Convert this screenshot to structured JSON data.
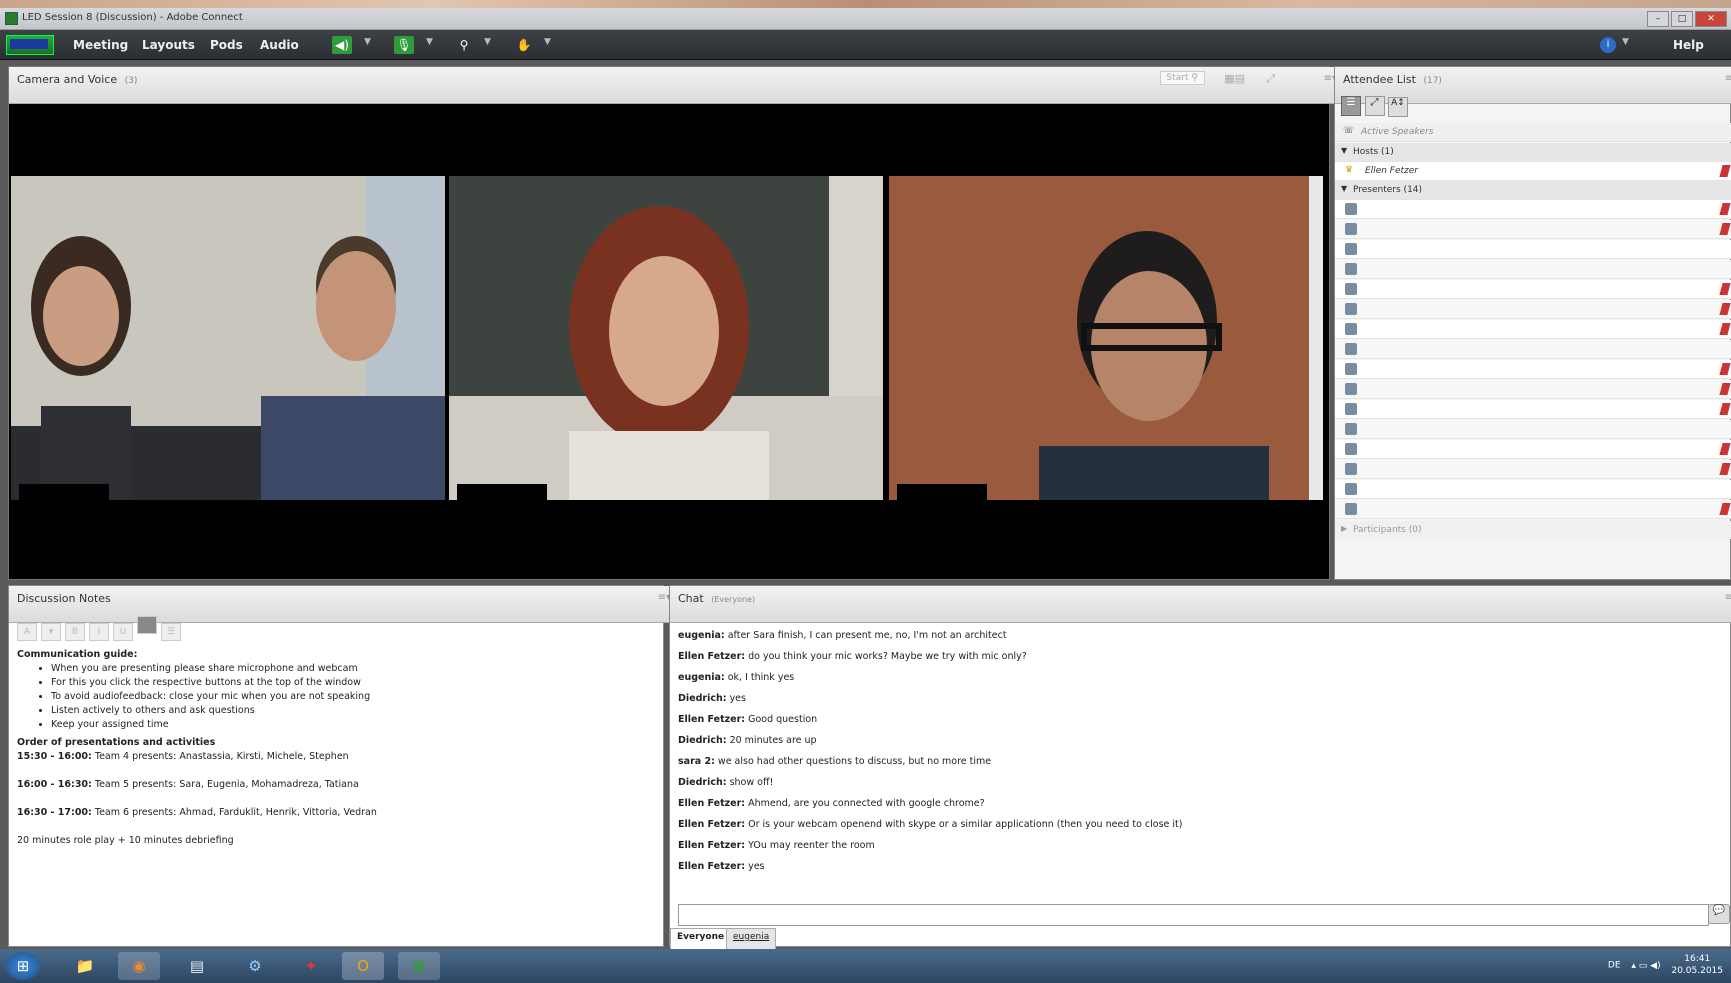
{
  "window": {
    "title": "LED Session 8 (Discussion) - Adobe Connect"
  },
  "menu": {
    "items": [
      "Meeting",
      "Layouts",
      "Pods",
      "Audio"
    ],
    "help": "Help"
  },
  "camera_pod": {
    "title": "Camera and Voice",
    "count": "(3)",
    "start_label": "Start"
  },
  "attendee_pod": {
    "title": "Attendee List",
    "count": "(17)",
    "active_speakers": "Active Speakers",
    "hosts_label": "Hosts (1)",
    "host_name": "Ellen Fetzer",
    "presenters_label": "Presenters (14)",
    "participants_label": "Participants (0)"
  },
  "notes_pod": {
    "title": "Discussion Notes",
    "guide_heading": "Communication guide:",
    "guide_items": [
      "When you are presenting please share microphone and webcam",
      "For this you click the respective buttons at the top of the window",
      "To avoid audiofeedback: close your mic when you are not speaking",
      "Listen actively to others and ask questions",
      "Keep your assigned time"
    ],
    "order_heading": "Order of presentations and activities",
    "schedule": [
      {
        "time": "15:30 - 16:00:",
        "text": "Team 4 presents: Anastassia, Kirsti, Michele, Stephen"
      },
      {
        "time": "16:00 - 16:30:",
        "text": "Team 5 presents: Sara, Eugenia, Mohamadreza, Tatiana"
      },
      {
        "time": "16:30 - 17:00:",
        "text": "Team 6 presents: Ahmad, Farduklit, Henrik, Vittoria, Vedran"
      }
    ],
    "footer": "20 minutes role play + 10 minutes debriefing"
  },
  "chat_pod": {
    "title": "Chat",
    "scope": "(Everyone)",
    "messages": [
      {
        "from": "eugenia:",
        "text": "after Sara finish, I can present me, no, I'm not an architect"
      },
      {
        "from": "Ellen Fetzer:",
        "text": "do you think your mic works? Maybe we try with mic only?"
      },
      {
        "from": "eugenia:",
        "text": "ok, I think yes"
      },
      {
        "from": "Diedrich:",
        "text": "yes"
      },
      {
        "from": "Ellen Fetzer:",
        "text": "Good question"
      },
      {
        "from": "Diedrich:",
        "text": "20 minutes are up"
      },
      {
        "from": "sara 2:",
        "text": "we also had other questions to discuss, but no more time"
      },
      {
        "from": "Diedrich:",
        "text": "show off!"
      },
      {
        "from": "Ellen Fetzer:",
        "text": "Ahmend, are you connected with google chrome?"
      },
      {
        "from": "Ellen Fetzer:",
        "text": "Or is your webcam openend with skype or a similar applicationn (then you need to close it)"
      },
      {
        "from": "Ellen Fetzer:",
        "text": "YOu may reenter the room"
      },
      {
        "from": "Ellen Fetzer:",
        "text": "yes"
      }
    ],
    "input_value": "",
    "tabs": [
      "Everyone",
      "eugenia"
    ]
  },
  "taskbar": {
    "lang": "DE",
    "time": "16:41",
    "date": "20.05.2015"
  }
}
